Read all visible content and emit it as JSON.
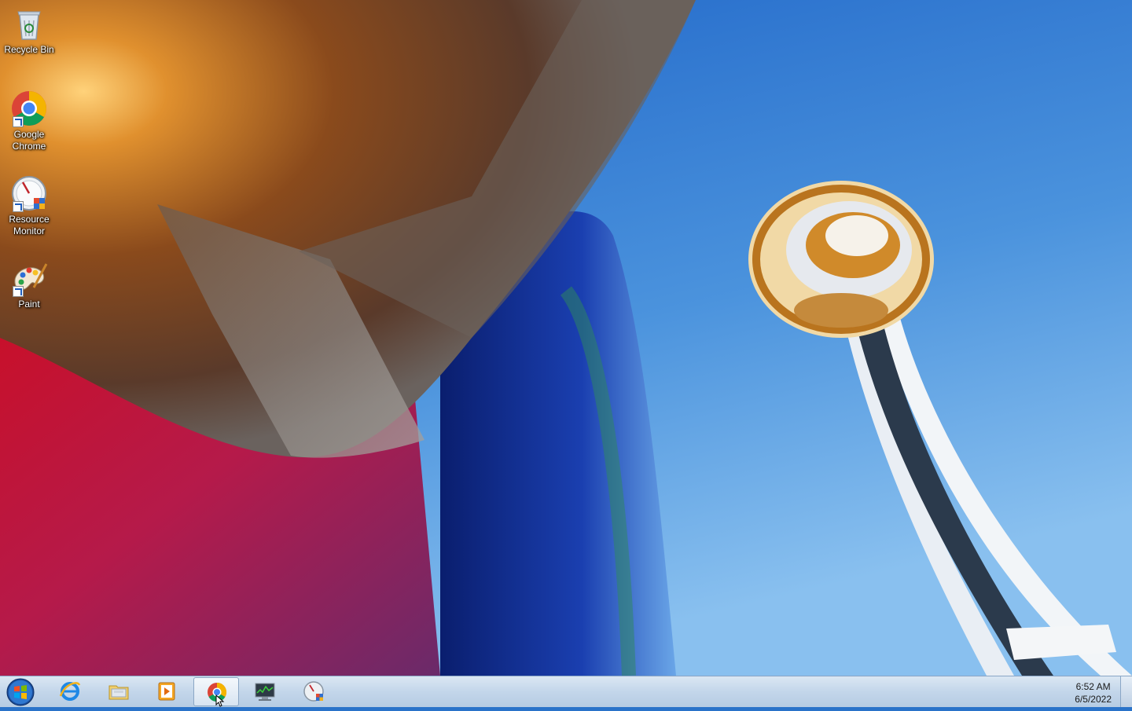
{
  "desktop": {
    "icons": [
      {
        "label": "Recycle Bin",
        "icon": "recycle-bin-icon"
      },
      {
        "label": "Google Chrome",
        "icon": "chrome-icon"
      },
      {
        "label": "Resource Monitor",
        "icon": "resource-monitor-icon"
      },
      {
        "label": "Paint",
        "icon": "paint-icon"
      }
    ]
  },
  "taskbar": {
    "start": "start-orb-icon",
    "pinned": [
      {
        "icon": "internet-explorer-icon"
      },
      {
        "icon": "file-explorer-icon"
      },
      {
        "icon": "media-player-icon"
      },
      {
        "icon": "chrome-icon",
        "active": true
      },
      {
        "icon": "task-manager-icon"
      },
      {
        "icon": "resource-monitor-icon"
      }
    ],
    "clock": {
      "time": "6:52 AM",
      "date": "6/5/2022"
    }
  },
  "colors": {
    "sky": "#2a73c9",
    "taskbar": "#c3d6ea",
    "tower_top": "#d59a3a"
  }
}
